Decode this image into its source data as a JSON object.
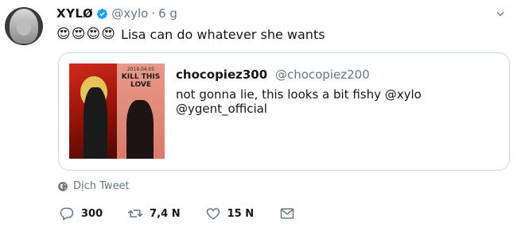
{
  "author": {
    "name": "XYLØ",
    "handle": "@xylo",
    "separator": "·",
    "time": "6 g"
  },
  "tweet": {
    "emojis": [
      "😍",
      "😍",
      "😍",
      "😍"
    ],
    "text": "Lisa can do whatever she wants"
  },
  "quoted": {
    "name": "chocopiez300",
    "handle": "@chocopiez200",
    "text": "not gonna lie, this looks a bit fishy @xylo @ygent_official",
    "image": {
      "date": "2019.04.05",
      "headline": "KILL THIS LOVE"
    }
  },
  "translate": {
    "label": "Dịch Tweet"
  },
  "actions": {
    "reply_count": "300",
    "retweet_count": "7,4 N",
    "like_count": "15 N"
  },
  "colors": {
    "verified": "#1da1f2",
    "muted": "#657786",
    "border": "#ccd6dd"
  },
  "icons": [
    "verified-badge-icon",
    "chevron-down-icon",
    "globe-icon",
    "reply-icon",
    "retweet-icon",
    "like-icon",
    "message-icon"
  ]
}
